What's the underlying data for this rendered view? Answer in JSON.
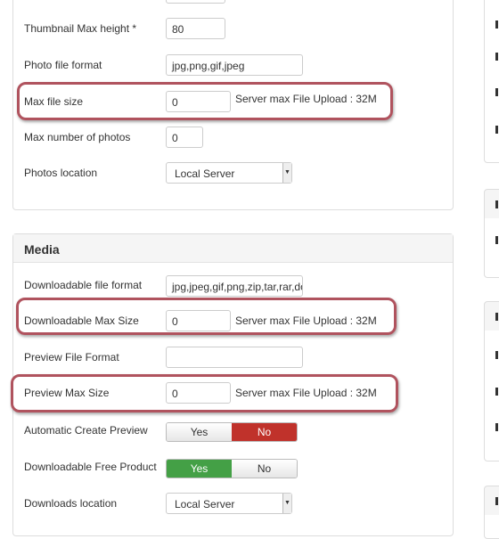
{
  "photos": {
    "rows": [
      {
        "label": "Thumbnail Max height *",
        "value": "80"
      },
      {
        "label": "Photo file format",
        "value": "jpg,png,gif,jpeg"
      },
      {
        "label": "Max file size",
        "value": "0",
        "note": "Server max File Upload : 32M"
      },
      {
        "label": "Max number of photos",
        "value": "0"
      },
      {
        "label": "Photos location",
        "value": "Local Server"
      }
    ]
  },
  "media": {
    "title": "Media",
    "downloadable_format": {
      "label": "Downloadable file format",
      "value": "jpg,jpeg,gif,png,zip,tar,rar,doc"
    },
    "downloadable_max": {
      "label": "Downloadable Max Size",
      "value": "0",
      "note": "Server max File Upload : 32M"
    },
    "preview_format": {
      "label": "Preview File Format",
      "value": ""
    },
    "preview_max": {
      "label": "Preview Max Size",
      "value": "0",
      "note": "Server max File Upload : 32M"
    },
    "auto_preview": {
      "label": "Automatic Create Preview",
      "yes": "Yes",
      "no": "No",
      "selected": "No"
    },
    "free_product": {
      "label": "Downloadable Free Product",
      "yes": "Yes",
      "no": "No",
      "selected": "Yes"
    },
    "location": {
      "label": "Downloads location",
      "value": "Local Server"
    }
  },
  "colors": {
    "highlight": "#b0535e",
    "no_active": "#c0322b",
    "yes_active": "#44a046"
  }
}
